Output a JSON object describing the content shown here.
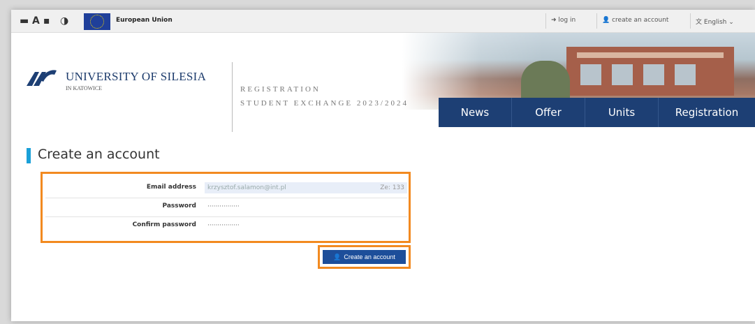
{
  "topbar": {
    "accessibility": [
      "▬",
      "A",
      "▪",
      "◑"
    ],
    "eu_label": "European Union",
    "login": "log in",
    "create_account": "create an account",
    "language": "English"
  },
  "header": {
    "university_name": "UNIVERSITY OF SILESIA",
    "university_sub": "IN KATOWICE",
    "registration_line1": "REGISTRATION",
    "registration_line2": "STUDENT EXCHANGE 2023/2024"
  },
  "nav": [
    "News",
    "Offer",
    "Units",
    "Registration"
  ],
  "page": {
    "title": "Create an account",
    "fields": [
      {
        "label": "Email address",
        "value": "krzysztof.salamon@int.pl",
        "suffix": "Ze: 133"
      },
      {
        "label": "Password",
        "value": "················"
      },
      {
        "label": "Confirm password",
        "value": "················"
      }
    ],
    "submit": "Create an account"
  },
  "colors": {
    "nav": "#1d3f74",
    "accent": "#1aa0d8",
    "highlight": "#f28a20",
    "button": "#1d4e9a"
  }
}
